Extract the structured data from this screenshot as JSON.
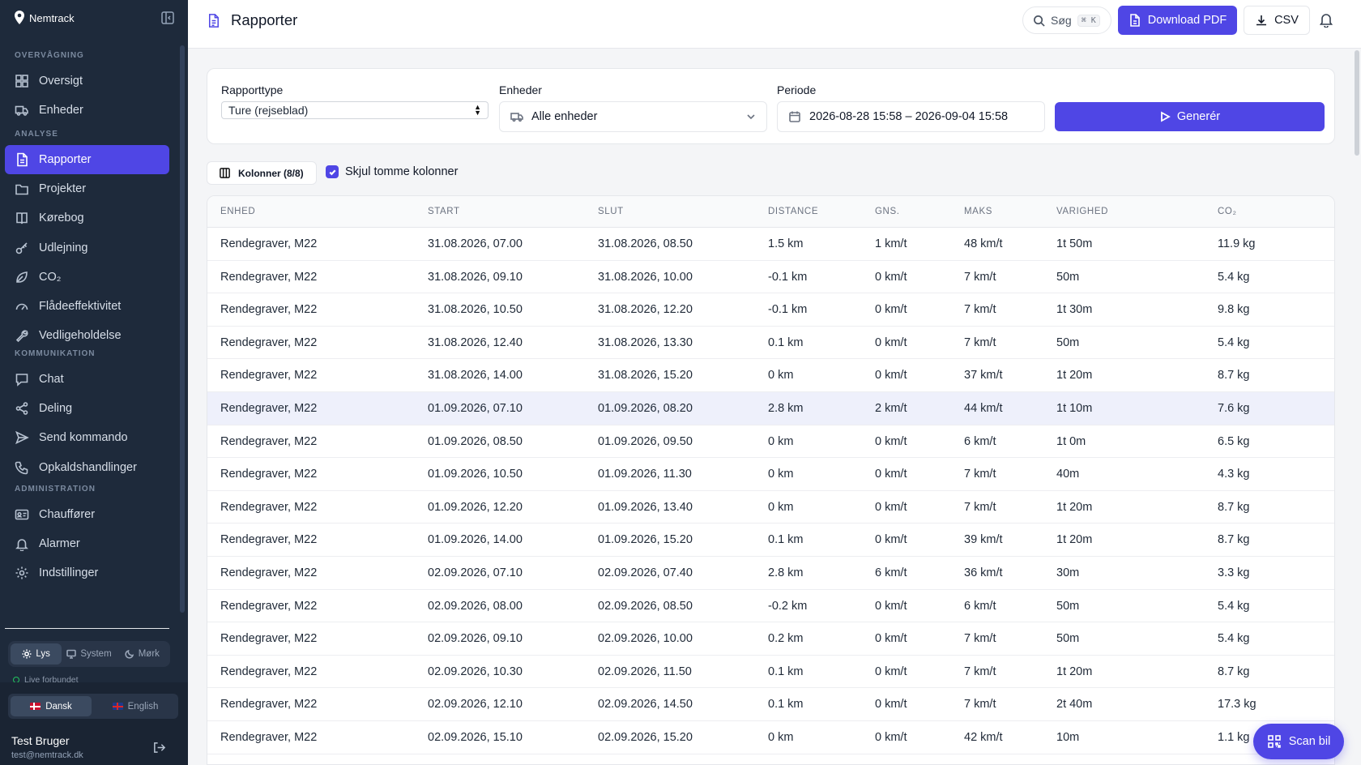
{
  "app": {
    "logo_text": "Nemtrack"
  },
  "sidebar": {
    "sections": [
      {
        "label": "OVERVÅGNING",
        "items": [
          {
            "label": "Oversigt",
            "icon": "grid-icon"
          },
          {
            "label": "Enheder",
            "icon": "truck-icon"
          }
        ]
      },
      {
        "label": "ANALYSE",
        "items": [
          {
            "label": "Rapporter",
            "icon": "file-icon",
            "active": true
          },
          {
            "label": "Projekter",
            "icon": "folder-icon"
          },
          {
            "label": "Kørebog",
            "icon": "book-icon"
          },
          {
            "label": "Udlejning",
            "icon": "key-icon"
          },
          {
            "label": "CO₂",
            "icon": "leaf-icon"
          },
          {
            "label": "Flådeeffektivitet",
            "icon": "gauge-icon"
          },
          {
            "label": "Vedligeholdelse",
            "icon": "wrench-icon"
          }
        ]
      },
      {
        "label": "KOMMUNIKATION",
        "items": [
          {
            "label": "Chat",
            "icon": "chat-icon"
          },
          {
            "label": "Deling",
            "icon": "share-icon"
          },
          {
            "label": "Send kommando",
            "icon": "send-icon"
          },
          {
            "label": "Opkaldshandlinger",
            "icon": "phone-icon"
          }
        ]
      },
      {
        "label": "ADMINISTRATION",
        "items": [
          {
            "label": "Chauffører",
            "icon": "id-card-icon"
          },
          {
            "label": "Alarmer",
            "icon": "bell-icon"
          },
          {
            "label": "Indstillinger",
            "icon": "gear-icon"
          }
        ]
      }
    ],
    "theme": {
      "light": "Lys",
      "system": "System",
      "dark": "Mørk",
      "selected": "Lys"
    },
    "live_status": "Live forbundet",
    "languages": {
      "da": "Dansk",
      "en": "English",
      "selected": "Dansk"
    },
    "user": {
      "name": "Test Bruger",
      "email": "test@nemtrack.dk"
    }
  },
  "header": {
    "title": "Rapporter",
    "search_label": "Søg",
    "search_shortcut": "⌘ K",
    "download_pdf": "Download PDF",
    "csv": "CSV"
  },
  "filters": {
    "report_type_label": "Rapporttype",
    "report_type_value": "Ture (rejseblad)",
    "units_label": "Enheder",
    "units_value": "Alle enheder",
    "period_label": "Periode",
    "period_value": "2026-08-28 15:58 – 2026-09-04 15:58",
    "generate": "Generér"
  },
  "toolbar": {
    "columns_button": "Kolonner (8/8)",
    "hide_empty_label": "Skjul tomme kolonner",
    "hide_empty_checked": true
  },
  "table": {
    "columns": [
      "ENHED",
      "START",
      "SLUT",
      "DISTANCE",
      "GNS.",
      "MAKS",
      "VARIGHED",
      "CO₂"
    ],
    "rows": [
      [
        "Rendegraver, M22",
        "31.08.2026, 07.00",
        "31.08.2026, 08.50",
        "1.5 km",
        "1 km/t",
        "48 km/t",
        "1t 50m",
        "11.9 kg"
      ],
      [
        "Rendegraver, M22",
        "31.08.2026, 09.10",
        "31.08.2026, 10.00",
        "-0.1 km",
        "0 km/t",
        "7 km/t",
        "50m",
        "5.4 kg"
      ],
      [
        "Rendegraver, M22",
        "31.08.2026, 10.50",
        "31.08.2026, 12.20",
        "-0.1 km",
        "0 km/t",
        "7 km/t",
        "1t 30m",
        "9.8 kg"
      ],
      [
        "Rendegraver, M22",
        "31.08.2026, 12.40",
        "31.08.2026, 13.30",
        "0.1 km",
        "0 km/t",
        "7 km/t",
        "50m",
        "5.4 kg"
      ],
      [
        "Rendegraver, M22",
        "31.08.2026, 14.00",
        "31.08.2026, 15.20",
        "0 km",
        "0 km/t",
        "37 km/t",
        "1t 20m",
        "8.7 kg"
      ],
      [
        "Rendegraver, M22",
        "01.09.2026, 07.10",
        "01.09.2026, 08.20",
        "2.8 km",
        "2 km/t",
        "44 km/t",
        "1t 10m",
        "7.6 kg"
      ],
      [
        "Rendegraver, M22",
        "01.09.2026, 08.50",
        "01.09.2026, 09.50",
        "0 km",
        "0 km/t",
        "6 km/t",
        "1t 0m",
        "6.5 kg"
      ],
      [
        "Rendegraver, M22",
        "01.09.2026, 10.50",
        "01.09.2026, 11.30",
        "0 km",
        "0 km/t",
        "7 km/t",
        "40m",
        "4.3 kg"
      ],
      [
        "Rendegraver, M22",
        "01.09.2026, 12.20",
        "01.09.2026, 13.40",
        "0 km",
        "0 km/t",
        "7 km/t",
        "1t 20m",
        "8.7 kg"
      ],
      [
        "Rendegraver, M22",
        "01.09.2026, 14.00",
        "01.09.2026, 15.20",
        "0.1 km",
        "0 km/t",
        "39 km/t",
        "1t 20m",
        "8.7 kg"
      ],
      [
        "Rendegraver, M22",
        "02.09.2026, 07.10",
        "02.09.2026, 07.40",
        "2.8 km",
        "6 km/t",
        "36 km/t",
        "30m",
        "3.3 kg"
      ],
      [
        "Rendegraver, M22",
        "02.09.2026, 08.00",
        "02.09.2026, 08.50",
        "-0.2 km",
        "0 km/t",
        "6 km/t",
        "50m",
        "5.4 kg"
      ],
      [
        "Rendegraver, M22",
        "02.09.2026, 09.10",
        "02.09.2026, 10.00",
        "0.2 km",
        "0 km/t",
        "7 km/t",
        "50m",
        "5.4 kg"
      ],
      [
        "Rendegraver, M22",
        "02.09.2026, 10.30",
        "02.09.2026, 11.50",
        "0.1 km",
        "0 km/t",
        "7 km/t",
        "1t 20m",
        "8.7 kg"
      ],
      [
        "Rendegraver, M22",
        "02.09.2026, 12.10",
        "02.09.2026, 14.50",
        "0.1 km",
        "0 km/t",
        "7 km/t",
        "2t 40m",
        "17.3 kg"
      ],
      [
        "Rendegraver, M22",
        "02.09.2026, 15.10",
        "02.09.2026, 15.20",
        "0 km",
        "0 km/t",
        "42 km/t",
        "10m",
        "1.1 kg"
      ]
    ],
    "highlighted_row": 5
  },
  "fab": {
    "label": "Scan bil"
  },
  "colors": {
    "accent": "#4f46e5",
    "sidebar_bg": "#1e2a3b"
  }
}
